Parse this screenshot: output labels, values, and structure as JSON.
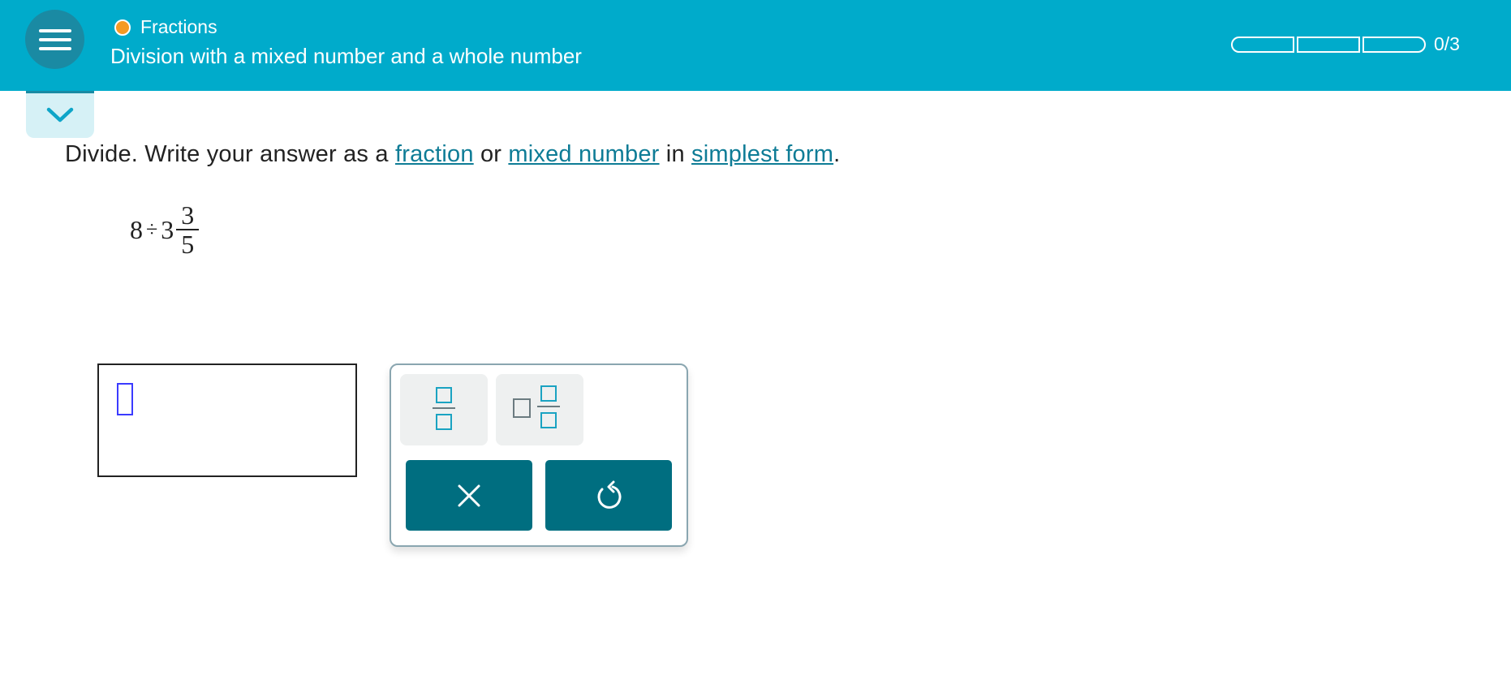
{
  "header": {
    "topic": "Fractions",
    "skill_title": "Division with a mixed number and a whole number",
    "progress_text": "0/3",
    "progress_fraction": 0,
    "progress_segments": 3
  },
  "instructions": {
    "lead": "Divide. Write your answer as a ",
    "link_fraction": "fraction",
    "mid1": " or ",
    "link_mixed_number": "mixed number",
    "mid2": " in ",
    "link_simplest_form": "simplest form",
    "end": "."
  },
  "problem": {
    "whole_number": "8",
    "operator": "÷",
    "mixed_whole": "3",
    "numerator": "3",
    "denominator": "5"
  },
  "answer": {
    "value": ""
  },
  "keypad": {
    "buttons": [
      "fraction-template",
      "mixed-number-template",
      "clear",
      "undo"
    ]
  },
  "colors": {
    "header_bg": "#00abcb",
    "accent_dot": "#f59a23",
    "link": "#0e7c96",
    "action_button": "#006e80",
    "template_icon": "#1aa3c2",
    "cursor_slot": "#3b3bff"
  }
}
